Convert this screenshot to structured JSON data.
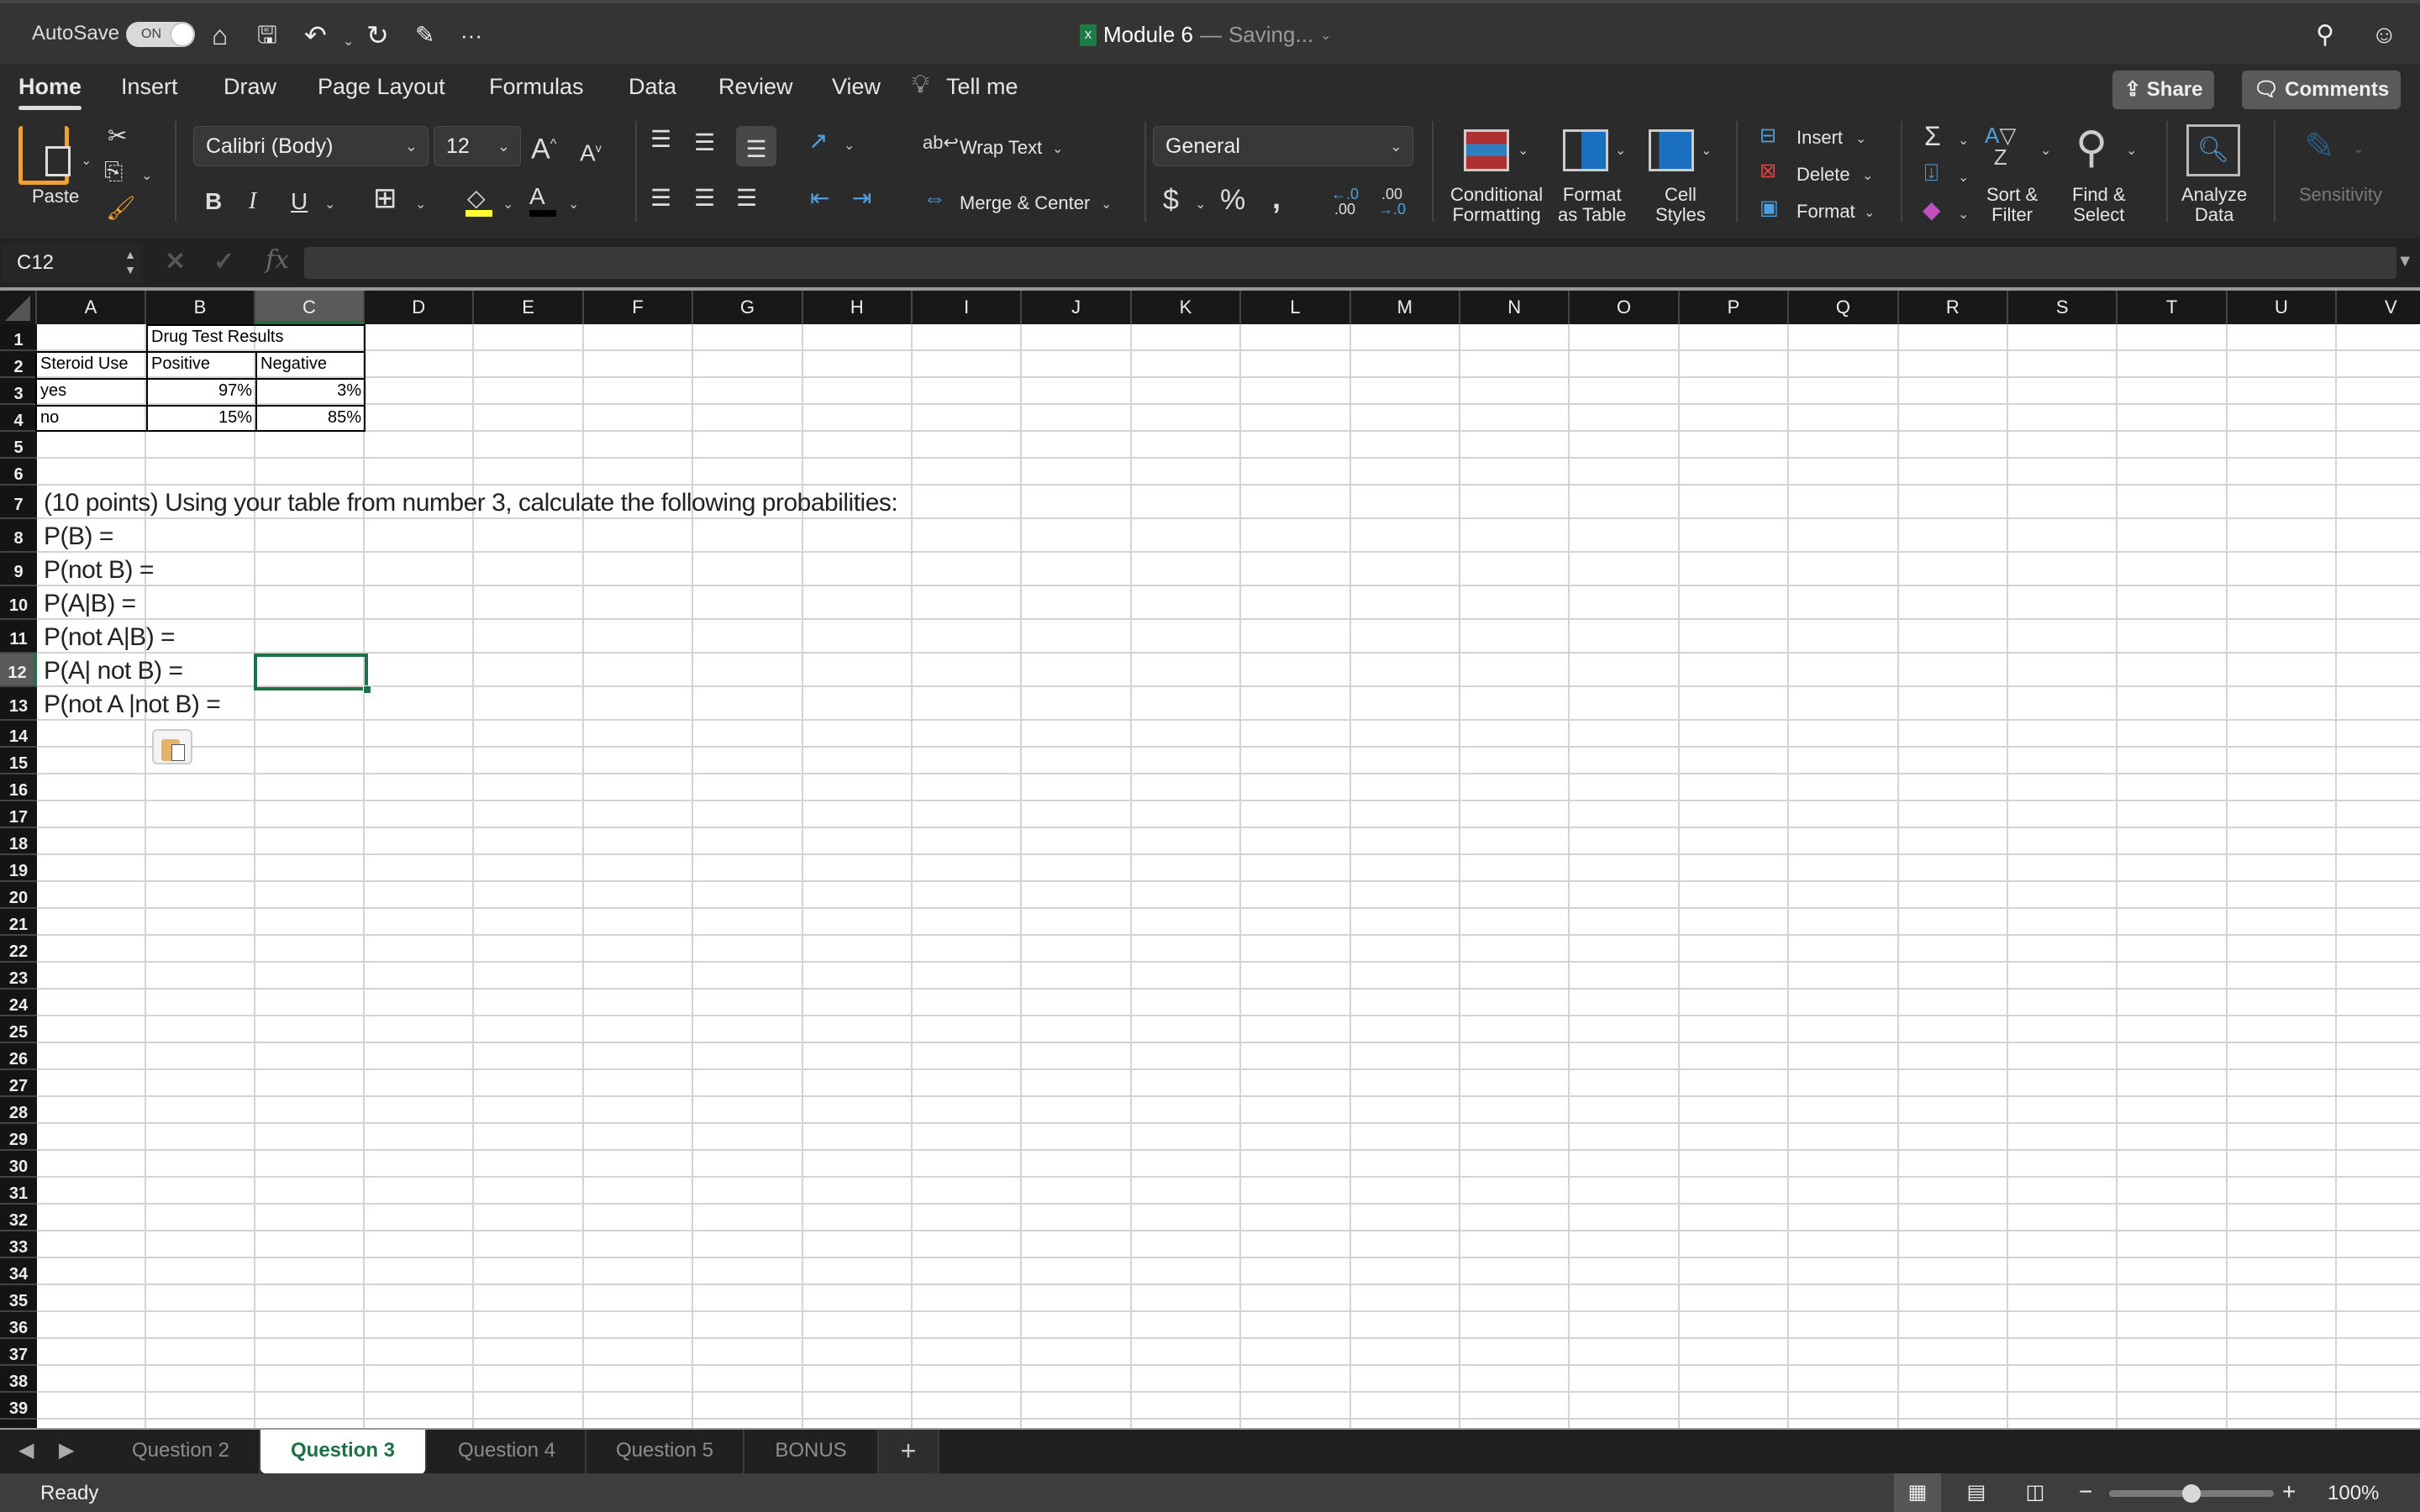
{
  "titlebar": {
    "autosave_label": "AutoSave",
    "autosave_state": "ON",
    "doc_name": "Module 6",
    "doc_sep": "—",
    "doc_status": "Saving...",
    "excel_badge": "X",
    "more": "···"
  },
  "ribbon_tabs": [
    "Home",
    "Insert",
    "Draw",
    "Page Layout",
    "Formulas",
    "Data",
    "Review",
    "View"
  ],
  "tell_me": "Tell me",
  "share_label": "Share",
  "comments_label": "Comments",
  "ribbon": {
    "paste": "Paste",
    "font_name": "Calibri (Body)",
    "font_size": "12",
    "wrap_text": "Wrap Text",
    "merge_center": "Merge & Center",
    "number_format": "General",
    "conditional_formatting": [
      "Conditional",
      "Formatting"
    ],
    "format_as_table": [
      "Format",
      "as Table"
    ],
    "cell_styles": [
      "Cell",
      "Styles"
    ],
    "insert": "Insert",
    "delete": "Delete",
    "format": "Format",
    "sort_filter": [
      "Sort &",
      "Filter"
    ],
    "find_select": [
      "Find &",
      "Select"
    ],
    "analyze_data": [
      "Analyze",
      "Data"
    ],
    "sensitivity": "Sensitivity",
    "colors": {
      "highlight": "#ffff33",
      "font_color": "#000000",
      "accent": "#1e7145"
    }
  },
  "formula_bar": {
    "name_box": "C12",
    "fx": "fx",
    "value": ""
  },
  "columns": [
    "A",
    "B",
    "C",
    "D",
    "E",
    "F",
    "G",
    "H",
    "I",
    "J",
    "K",
    "L",
    "M",
    "N",
    "O",
    "P",
    "Q",
    "R",
    "S",
    "T",
    "U",
    "V"
  ],
  "selected_column": "C",
  "selected_row": 12,
  "rows": [
    "1",
    "2",
    "3",
    "4",
    "5",
    "6",
    "7",
    "8",
    "9",
    "10",
    "11",
    "12",
    "13",
    "14",
    "15",
    "16",
    "17",
    "18",
    "19",
    "20",
    "21",
    "22",
    "23",
    "24",
    "25",
    "26",
    "27",
    "28",
    "29",
    "30",
    "31",
    "32",
    "33",
    "34",
    "35",
    "36",
    "37",
    "38",
    "39"
  ],
  "table": {
    "title": "Drug Test Results",
    "row_header": "Steroid Use",
    "col_headers": [
      "Positive",
      "Negative"
    ],
    "rows": [
      {
        "label": "yes",
        "values": [
          "97%",
          "3%"
        ]
      },
      {
        "label": "no",
        "values": [
          "15%",
          "85%"
        ]
      }
    ]
  },
  "question": {
    "prompt": "(10 points) Using your table from number 3, calculate the following probabilities:",
    "items": [
      "P(B) =",
      "P(not B) =",
      "P(A|B) =",
      "P(not A|B) =",
      "P(A| not B) =",
      "P(not A |not B) ="
    ]
  },
  "sheets": [
    {
      "name": "Question 2",
      "active": false
    },
    {
      "name": "Question 3",
      "active": true
    },
    {
      "name": "Question 4",
      "active": false
    },
    {
      "name": "Question 5",
      "active": false
    },
    {
      "name": "BONUS",
      "active": false
    }
  ],
  "add_sheet": "+",
  "status": {
    "text": "Ready",
    "zoom": "100%",
    "zoom_fraction": 0.5
  }
}
